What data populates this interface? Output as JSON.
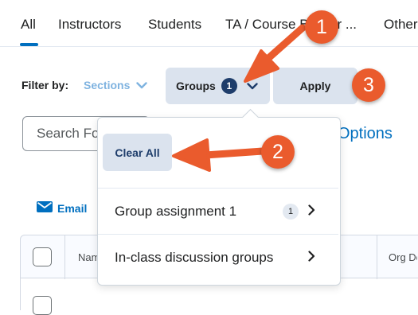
{
  "tabs": [
    {
      "label": "All",
      "active": true
    },
    {
      "label": "Instructors",
      "active": false
    },
    {
      "label": "Students",
      "active": false
    },
    {
      "label": "TA / Course Builder ...",
      "active": false
    },
    {
      "label": "Other",
      "active": false
    }
  ],
  "filter": {
    "label": "Filter by:",
    "sections_label": "Sections",
    "groups_label": "Groups",
    "groups_count": "1",
    "apply_label": "Apply"
  },
  "search": {
    "placeholder": "Search For...",
    "options_label": "Options"
  },
  "email_label": "Email",
  "groups_dropdown": {
    "clear_all_label": "Clear All",
    "items": [
      {
        "label": "Group assignment 1",
        "count": "1"
      },
      {
        "label": "In-class discussion groups"
      }
    ]
  },
  "table": {
    "columns": [
      "Name",
      "Org Defined ID"
    ]
  },
  "annotations": {
    "marker_1": "1",
    "marker_2": "2",
    "marker_3": "3",
    "color": "#ea5b2d"
  },
  "colors": {
    "accent": "#006fbf",
    "button_bg": "#dbe3ee",
    "badge_bg": "#1e3d6b"
  }
}
